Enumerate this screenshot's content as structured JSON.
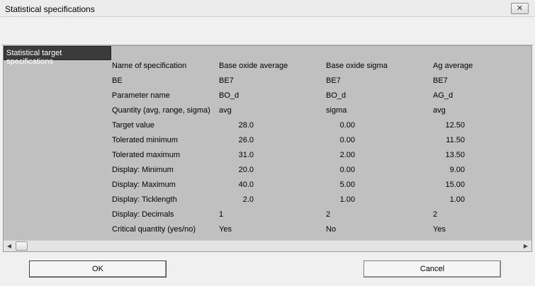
{
  "window": {
    "title": "Statistical specifications",
    "close_glyph": "✕"
  },
  "panel": {
    "header": "Statistical target specifications",
    "rows": [
      {
        "label": "Name of specification",
        "values": [
          "Base oxide average",
          "Base oxide sigma",
          "Ag average"
        ],
        "numeric": false
      },
      {
        "label": "BE",
        "values": [
          "BE7",
          "BE7",
          "BE7"
        ],
        "numeric": false
      },
      {
        "label": "Parameter name",
        "values": [
          "BO_d",
          "BO_d",
          "AG_d"
        ],
        "numeric": false
      },
      {
        "label": "Quantity (avg, range, sigma)",
        "values": [
          "avg",
          "sigma",
          "avg"
        ],
        "numeric": false
      },
      {
        "label": "Target value",
        "values": [
          "28.0",
          "0.00",
          "12.50"
        ],
        "numeric": true
      },
      {
        "label": "Tolerated minimum",
        "values": [
          "26.0",
          "0.00",
          "11.50"
        ],
        "numeric": true
      },
      {
        "label": "Tolerated maximum",
        "values": [
          "31.0",
          "2.00",
          "13.50"
        ],
        "numeric": true
      },
      {
        "label": "Display: Minimum",
        "values": [
          "20.0",
          "0.00",
          "9.00"
        ],
        "numeric": true
      },
      {
        "label": "Display: Maximum",
        "values": [
          "40.0",
          "5.00",
          "15.00"
        ],
        "numeric": true
      },
      {
        "label": "Display: Ticklength",
        "values": [
          "2.0",
          "1.00",
          "1.00"
        ],
        "numeric": true
      },
      {
        "label": "Display: Decimals",
        "values": [
          "1",
          "2",
          "2"
        ],
        "numeric": false
      },
      {
        "label": "Critical quantity (yes/no)",
        "values": [
          "Yes",
          "No",
          "Yes"
        ],
        "numeric": false
      }
    ]
  },
  "scrollbar": {
    "left_arrow_icon": "scroll-left-arrow",
    "right_arrow_icon": "scroll-right-arrow",
    "left_glyph": "◀",
    "right_glyph": "▶"
  },
  "buttons": {
    "ok_label": "OK",
    "cancel_label": "Cancel"
  },
  "colors": {
    "panel_bg": "#c0c0c0",
    "header_bg": "#3b3b3b",
    "window_bg": "#f0f0f0"
  }
}
